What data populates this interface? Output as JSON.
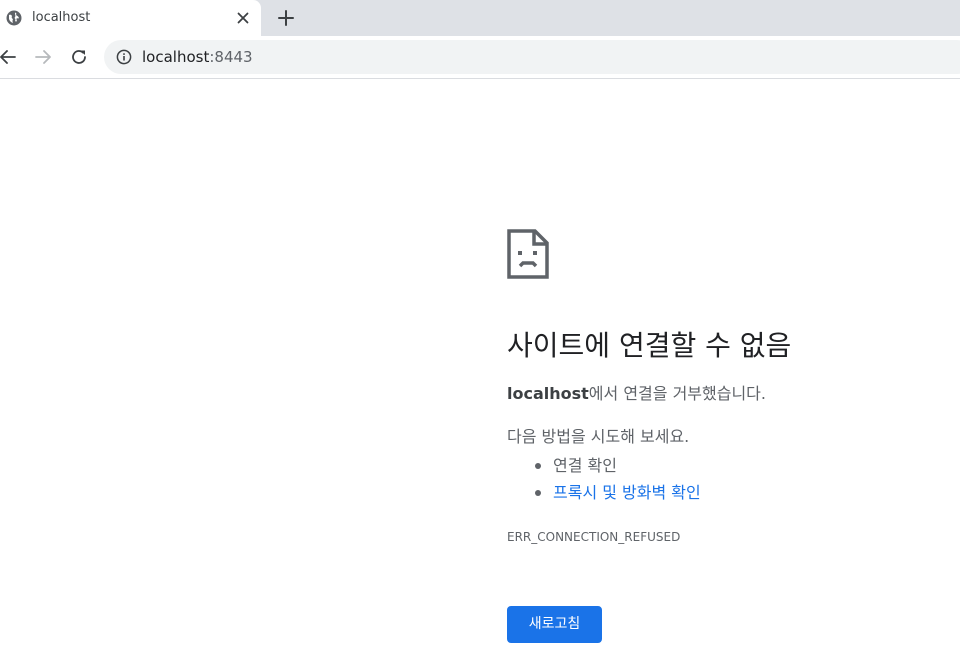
{
  "browser": {
    "tab": {
      "title": "localhost",
      "favicon": "globe-icon"
    },
    "new_tab_icon": "plus-icon",
    "toolbar": {
      "back_icon": "arrow-left-icon",
      "forward_icon": "arrow-right-icon",
      "reload_icon": "reload-icon",
      "site_info_icon": "info-icon"
    },
    "address": {
      "host": "localhost",
      "port": ":8443"
    }
  },
  "error_page": {
    "icon": "sad-document-icon",
    "heading": "사이트에 연결할 수 없음",
    "description": {
      "host": "localhost",
      "message": "에서 연결을 거부했습니다."
    },
    "suggestions_intro": "다음 방법을 시도해 보세요.",
    "suggestions": [
      {
        "label": "연결 확인",
        "is_link": false
      },
      {
        "label": "프록시 및 방화벽 확인",
        "is_link": true
      }
    ],
    "error_code": "ERR_CONNECTION_REFUSED",
    "reload_button_label": "새로고침"
  },
  "colors": {
    "accent": "#1a73e8",
    "text_primary": "#202124",
    "text_secondary": "#5f6368",
    "tabstrip_bg": "#dee1e6",
    "omnibox_bg": "#f1f3f4"
  }
}
